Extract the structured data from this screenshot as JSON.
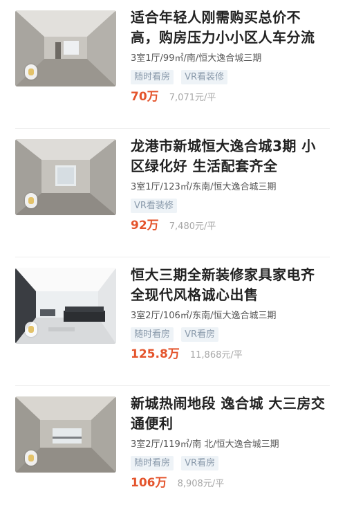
{
  "listings": [
    {
      "title_line1": "适合年轻人刚需购买总价不",
      "title_line2": "高，购房压力小小区人车分流",
      "meta": "3室1厅/99㎡/南/恒大逸合城三期",
      "tags": [
        "随时看房",
        "VR看装修"
      ],
      "price": "70万",
      "unit_price": "7,071元/平",
      "thumb": "rough-room"
    },
    {
      "title_line1": "龙港市新城恒大逸合城3期 小",
      "title_line2": "区绿化好 生活配套齐全",
      "meta": "3室1厅/123㎡/东南/恒大逸合城三期",
      "tags": [
        "VR看装修"
      ],
      "price": "92万",
      "unit_price": "7,480元/平",
      "thumb": "rough-room-window"
    },
    {
      "title_line1": "恒大三期全新装修家具家电齐",
      "title_line2": "全现代风格诚心出售",
      "meta": "3室2厅/106㎡/东南/恒大逸合城三期",
      "tags": [
        "随时看房",
        "VR看房"
      ],
      "price": "125.8万",
      "unit_price": "11,868元/平",
      "thumb": "furnished-living-room"
    },
    {
      "title_line1": "新城热闹地段 逸合城 大三房交",
      "title_line2": "通便利",
      "meta": "3室2厅/119㎡/南 北/恒大逸合城三期",
      "tags": [
        "随时看房",
        "VR看房"
      ],
      "price": "106万",
      "unit_price": "8,908元/平",
      "thumb": "rough-room-balcony"
    }
  ],
  "colors": {
    "price": "#e4542c",
    "tag_bg": "#eef3f7",
    "tag_text": "#8a9aab",
    "title": "#222222"
  }
}
